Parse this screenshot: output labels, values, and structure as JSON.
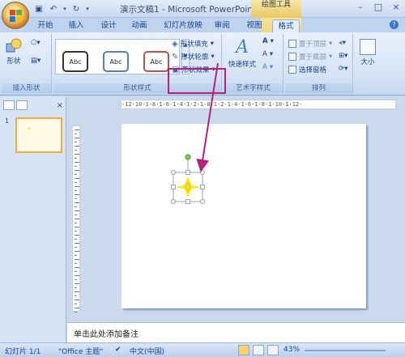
{
  "window": {
    "title": "演示文稿1 - Microsoft PowerPoint",
    "context_tool_title": "绘图工具",
    "min": "–",
    "max": "□",
    "close": "×"
  },
  "tabs": [
    "开始",
    "插入",
    "设计",
    "动画",
    "幻灯片放映",
    "审阅",
    "视图",
    "格式"
  ],
  "active_tab": "格式",
  "ribbon": {
    "insert_shapes": {
      "label": "插入形状",
      "shapes_btn": "形状"
    },
    "shape_styles": {
      "label": "形状样式",
      "styles": [
        "Abc",
        "Abc",
        "Abc"
      ],
      "fill": "形状填充",
      "outline": "形状轮廓",
      "effects": "形状效果"
    },
    "wordart": {
      "label": "艺术字样式",
      "quick": "快速样式",
      "A1": "A",
      "A2": "A",
      "A3": "A"
    },
    "arrange": {
      "label": "排列",
      "front": "置于顶层",
      "back": "置于底层",
      "pane": "选择窗格"
    },
    "size": {
      "label": "大小"
    }
  },
  "left_pane": {
    "slide_number": "1"
  },
  "ruler": {
    "h": "·12·10·1·8·1·6·1·4·1·2·1·0·1·2·1·4·1·6·1·8·1·10·1·12·"
  },
  "notes": {
    "placeholder": "单击此处添加备注"
  },
  "status": {
    "slide": "幻灯片 1/1",
    "theme": "\"Office 主题\"",
    "language": "中文(中国)",
    "zoom": "43%"
  },
  "colors": {
    "highlight": "#b5207a",
    "star": "#ffee00",
    "rotate_handle": "#7ed060"
  }
}
